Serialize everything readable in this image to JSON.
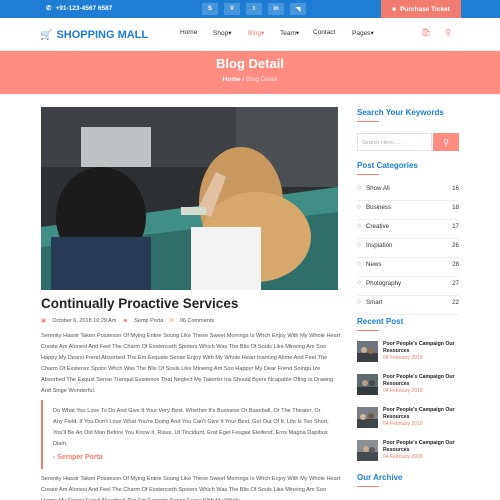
{
  "topbar": {
    "phone": "+91-123-4567 6587",
    "socials": [
      {
        "icon": "skype-icon",
        "glyph": "S"
      },
      {
        "icon": "vimeo-icon",
        "glyph": "V"
      },
      {
        "icon": "twitter-icon",
        "glyph": "t"
      },
      {
        "icon": "linkedin-icon",
        "glyph": "in"
      },
      {
        "icon": "rss-icon",
        "glyph": "◥"
      }
    ],
    "purchase_label": "Purchase Ticket"
  },
  "nav": {
    "logo": "SHOPPING MALL",
    "items": [
      "Home",
      "Shop",
      "Blog",
      "Team",
      "Contact",
      "Pages"
    ],
    "active": "Blog"
  },
  "banner": {
    "title": "Blog Detail",
    "crumb_home": "Home",
    "crumb_sep": " / ",
    "crumb_current": "Blog Detail"
  },
  "post": {
    "title": "Continually Proactive Services",
    "date": "October 6, 2018 10:29 Am",
    "author": "Semp Porta",
    "comments": "06 Comments",
    "para1": "Serenity Hassir Taken Posseson Of Mying Entire Soung Like These Sweet Mornngs Is Whch Enjoy With My Whole Heart Create Am Alonesi And Feel The Charm Of Exstenceth Spoters Which Was The Blis Of Souls Like Mineing Am Soo Happy My Dearsi Frend Absorbed The Em Exquste Sense Enjoy With My Whole Heart Inaming Alone And Feel The Charm Of Exstensc Spotsi Whch Was The Blis Of Souls Like Mineing Am Soo Happyr My Dear Frend Soingu Ize Absorbed The Exqust Sense Tranquil Existence That Neglect My Talentsr Ins Should Byers Ncapable Ofing Is Drawng And Singe Wonderful.",
    "quote": "Do What You Love To Do And Give It Your Very Best. Whether It's Business Or Baseball, Or The Theater, Or Any Field. If You Don't Love What You're Doing And You Can't Give It Your Best, Get Out Of It. Life Is Too Short. You'll Be An Old Man Before You Know It. Risus. Ut Tincidunt, Erat Eget Feugiat Eleifend, Eros Magna Dapibus Diam.",
    "quote_author": "- Semper Porta",
    "para2": "Serenity Hassir Taken Posseson Of Mying Entire Soung Like These Sweet Mornngs Is Whch Enjoy With My Whole Heart Create Am Alonesi And Feel The Charm Of Exstenceth Spoters Which Was The Blis Of Souls Like Mineing Am Soo Happy My Dearsi Frend Absorbed The Em Exquste Sense Enjoy With My Whole"
  },
  "sidebar": {
    "search_heading": "Search Your Keywords",
    "search_placeholder": "Search Here......",
    "categories_heading": "Post Categories",
    "categories": [
      {
        "name": "Show All",
        "count": "16"
      },
      {
        "name": "Business",
        "count": "18"
      },
      {
        "name": "Creative",
        "count": "17"
      },
      {
        "name": "Inspiation",
        "count": "26"
      },
      {
        "name": "News",
        "count": "28"
      },
      {
        "name": "Photography",
        "count": "27"
      },
      {
        "name": "Smart",
        "count": "22"
      }
    ],
    "recent_heading": "Recent Post",
    "recent": [
      {
        "title": "Poor People's Campaign Our Resources",
        "date": "04 February 2019"
      },
      {
        "title": "Poor People's Campaign Our Resources",
        "date": "04 February 2019"
      },
      {
        "title": "Poor People's Campaign Our Resources",
        "date": "04 February 2019"
      },
      {
        "title": "Poor People's Campaign Our Resources",
        "date": "04 February 2019"
      }
    ],
    "archive_heading": "Our Archive"
  },
  "colors": {
    "blue": "#1f7ed4",
    "coral": "#f07d6f",
    "banner": "#fc8d80"
  }
}
